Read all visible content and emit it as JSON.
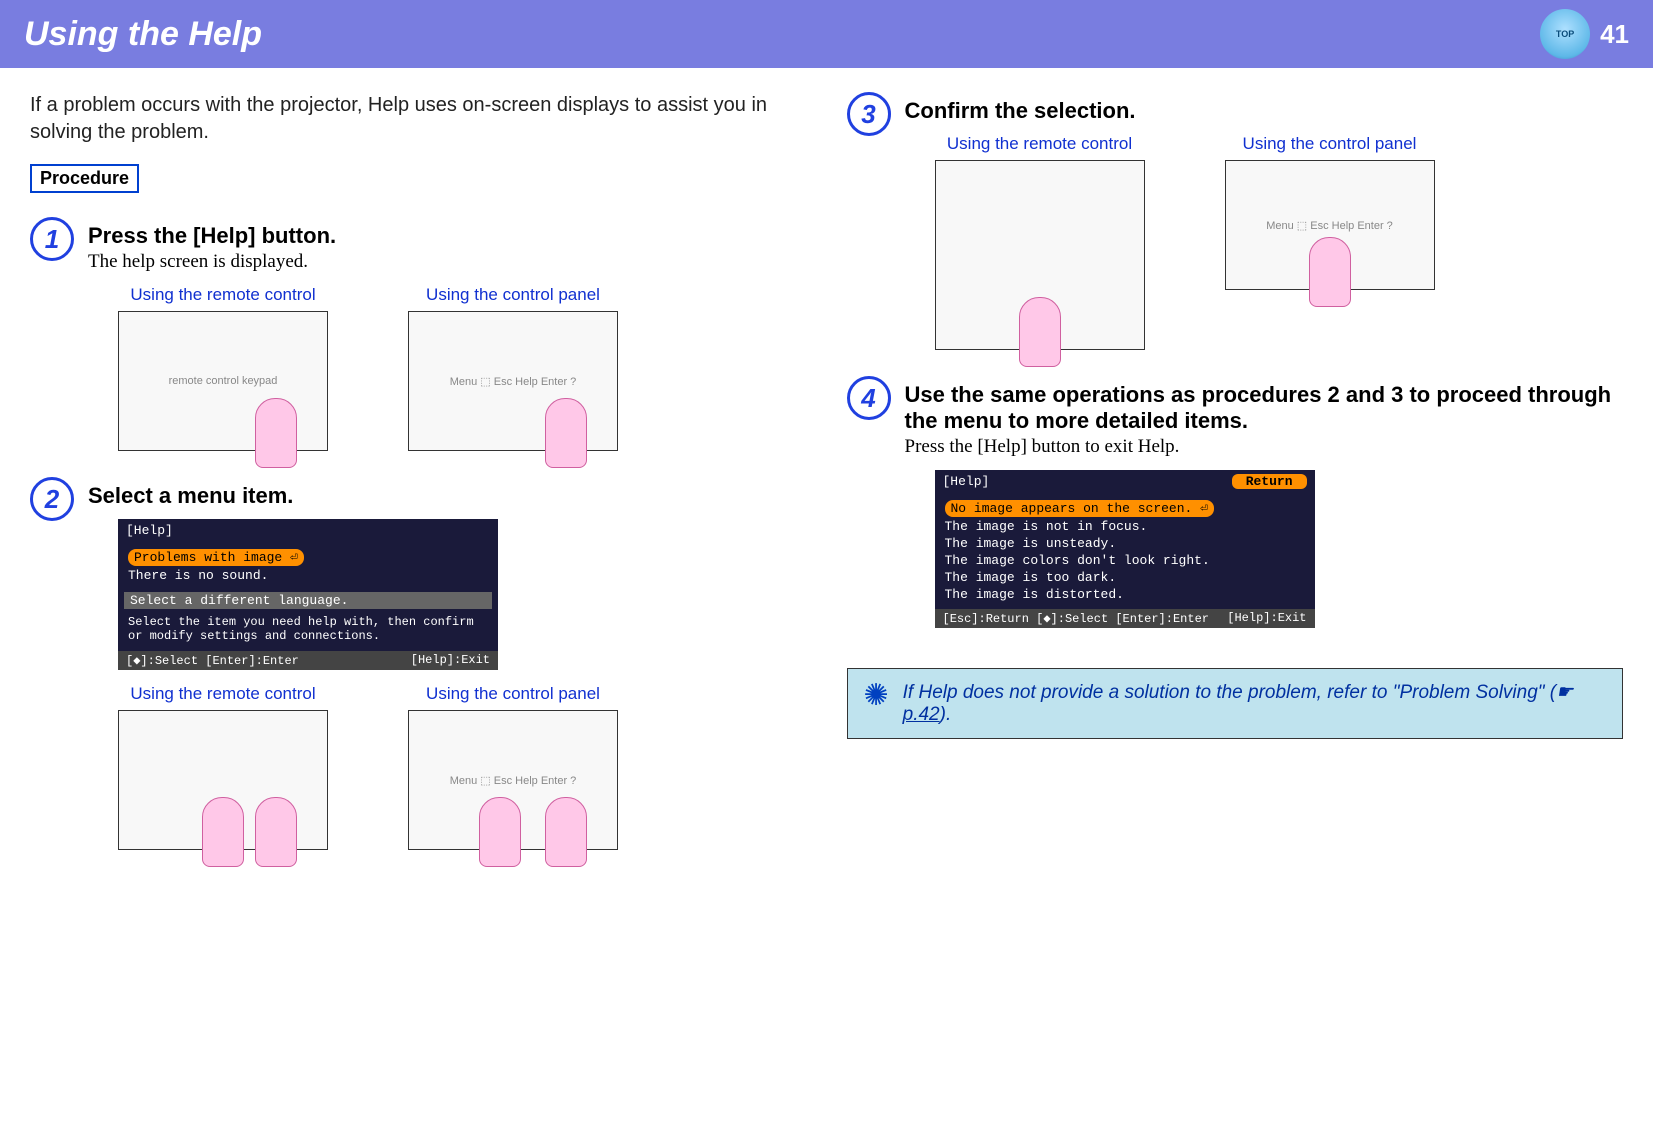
{
  "header": {
    "title": "Using the Help",
    "page_number": "41",
    "top_label": "TOP"
  },
  "intro": "If a problem occurs with the projector, Help uses on-screen displays to assist you in solving the problem.",
  "procedure_label": "Procedure",
  "captions": {
    "remote": "Using the remote control",
    "panel": "Using the control panel"
  },
  "steps": {
    "s1": {
      "num": "1",
      "title": "Press the [Help] button.",
      "sub": "The help screen is displayed."
    },
    "s2": {
      "num": "2",
      "title": "Select a menu item."
    },
    "s3": {
      "num": "3",
      "title": "Confirm the selection."
    },
    "s4": {
      "num": "4",
      "title": "Use the same operations as procedures 2 and 3 to proceed through the menu to more detailed items.",
      "sub": "Press the [Help] button to exit Help."
    }
  },
  "help_screen_1": {
    "titlebar": "[Help]",
    "lines": {
      "l1": "Problems with image ⏎",
      "l2": "There is no sound.",
      "l3": "Select a different language.",
      "hint": "Select the item you need help with, then confirm or modify settings and connections."
    },
    "footer_left": "[◆]:Select [Enter]:Enter",
    "footer_right": "[Help]:Exit"
  },
  "help_screen_2": {
    "titlebar": "[Help]",
    "return": "Return",
    "lines": {
      "l1": "No image appears on the screen. ⏎",
      "l2": "The image is not in focus.",
      "l3": "The image is unsteady.",
      "l4": "The image colors don't look right.",
      "l5": "The image is too dark.",
      "l6": "The image is distorted."
    },
    "footer_left": "[Esc]:Return [◆]:Select [Enter]:Enter",
    "footer_right": "[Help]:Exit"
  },
  "tip": {
    "text_before": "If Help does not provide a solution to the problem, refer to \"Problem Solving\" (",
    "link": "p.42",
    "text_after": ")."
  },
  "device_labels": {
    "remote_buttons": "remote control keypad",
    "panel_controls": "Menu  ⬚  Esc  Help  Enter  ?"
  }
}
